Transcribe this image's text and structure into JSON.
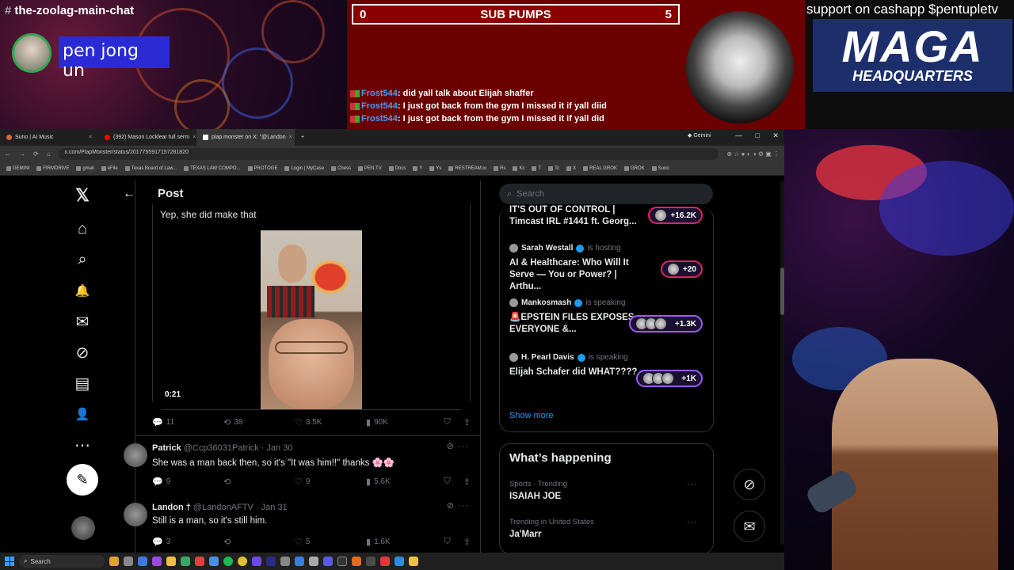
{
  "overlay": {
    "channel": "the-zoolag-main-chat",
    "channel_hash": "#",
    "username": "pen jong un",
    "pump_left": "0",
    "pump_title": "SUB PUMPS",
    "pump_right": "5",
    "chat": [
      {
        "user": "Frost544",
        "msg": ": did yall talk about Elijah shaffer"
      },
      {
        "user": "Frost544",
        "msg": ": I just got back from the gym I missed it if yall diid"
      },
      {
        "user": "Frost544",
        "msg": ": I just got back from the gym I missed it if yall did"
      }
    ],
    "cashapp": "support on cashapp $pentupletv",
    "maga_big": "MAGA",
    "maga_small": "HEADQUARTERS"
  },
  "browser": {
    "tabs": [
      {
        "label": "Suno | AI Music",
        "close": "×"
      },
      {
        "label": "(392) Mason Locklear full serm",
        "close": "×"
      },
      {
        "label": "plap monster on X: \"@Landon",
        "close": "×"
      }
    ],
    "new_tab": "+",
    "gemini": "Gemini",
    "window_controls": "— □ ✕",
    "url": "x.com/PlapMonster/status/2017755917157281820",
    "nav": [
      "←",
      "→",
      "⟳",
      "⌂"
    ],
    "bookmarks": [
      "GEMINI",
      "FIRMDRIVE",
      "gmail",
      "eFile",
      "Texas Board of Law...",
      "TEXAS LAW COMPO...",
      "PROTOGE",
      "Login | MyCase",
      "Chess",
      "PEN.TV",
      "Docs",
      "Y",
      "Ys",
      "RESTREAM.io",
      "Rs",
      "Kc",
      "T",
      "Tc",
      "X",
      "REAL GROK",
      "GROK",
      "Suno"
    ]
  },
  "x": {
    "post_header": "Post",
    "back": "←",
    "nav_icons": [
      "𝕏",
      "⌂",
      "⌕",
      "🔔",
      "✉",
      "⊘",
      "▤",
      "👤",
      "⋯"
    ],
    "post_button": "✎",
    "quote_text": "Yep, she did make that",
    "video_time": "0:21",
    "stats": [
      {
        "icon": "💬",
        "value": "11"
      },
      {
        "icon": "⟲",
        "value": "38"
      },
      {
        "icon": "♡",
        "value": "3.5K"
      },
      {
        "icon": "▮",
        "value": "90K"
      }
    ],
    "replies": [
      {
        "name": "Patrick",
        "meta": "@Ccp36031Patrick · Jan 30",
        "text": "She was a man back then, so it's \"It was him!!\" thanks 🌸🌸",
        "stats": [
          "9",
          "",
          "9",
          "5.6K"
        ]
      },
      {
        "name": "Landon †",
        "meta": "@LandonAFTV · Jan 31",
        "text": "Still is a man, so it's still him.",
        "stats": [
          "3",
          "",
          "5",
          "1.6K"
        ]
      }
    ],
    "search_placeholder": "Search",
    "spaces": [
      {
        "host": "",
        "status": "",
        "title": "IT'S OUT OF CONTROL | Timcast IRL #1441 ft. Georg...",
        "count": "+16.2K"
      },
      {
        "host": "Sarah Westall",
        "status": "is hosting",
        "title": "AI & Healthcare: Who Will It Serve — You or Power? | Arthu...",
        "count": "+20"
      },
      {
        "host": "Mankosmash",
        "status": "is speaking",
        "title": "🚨EPSTEIN FILES EXPOSES EVERYONE &...",
        "count": "+1.3K"
      },
      {
        "host": "H. Pearl Davis",
        "status": "is speaking",
        "title": "Elijah Schafer did WHAT????",
        "count": "+1K"
      }
    ],
    "show_more": "Show more",
    "happening_title": "What’s happening",
    "trends": [
      {
        "category": "Sports · Trending",
        "name": "ISAIAH JOE"
      },
      {
        "category": "Trending in United States",
        "name": "Ja'Marr"
      }
    ]
  },
  "taskbar": {
    "search": "Search"
  },
  "colors": {
    "x_blue": "#1d9bf0",
    "space_purple": "#9b5cf0",
    "space_pink": "#e0245e",
    "pump_red": "#8a0000",
    "name_box": "#2b2bd6"
  }
}
